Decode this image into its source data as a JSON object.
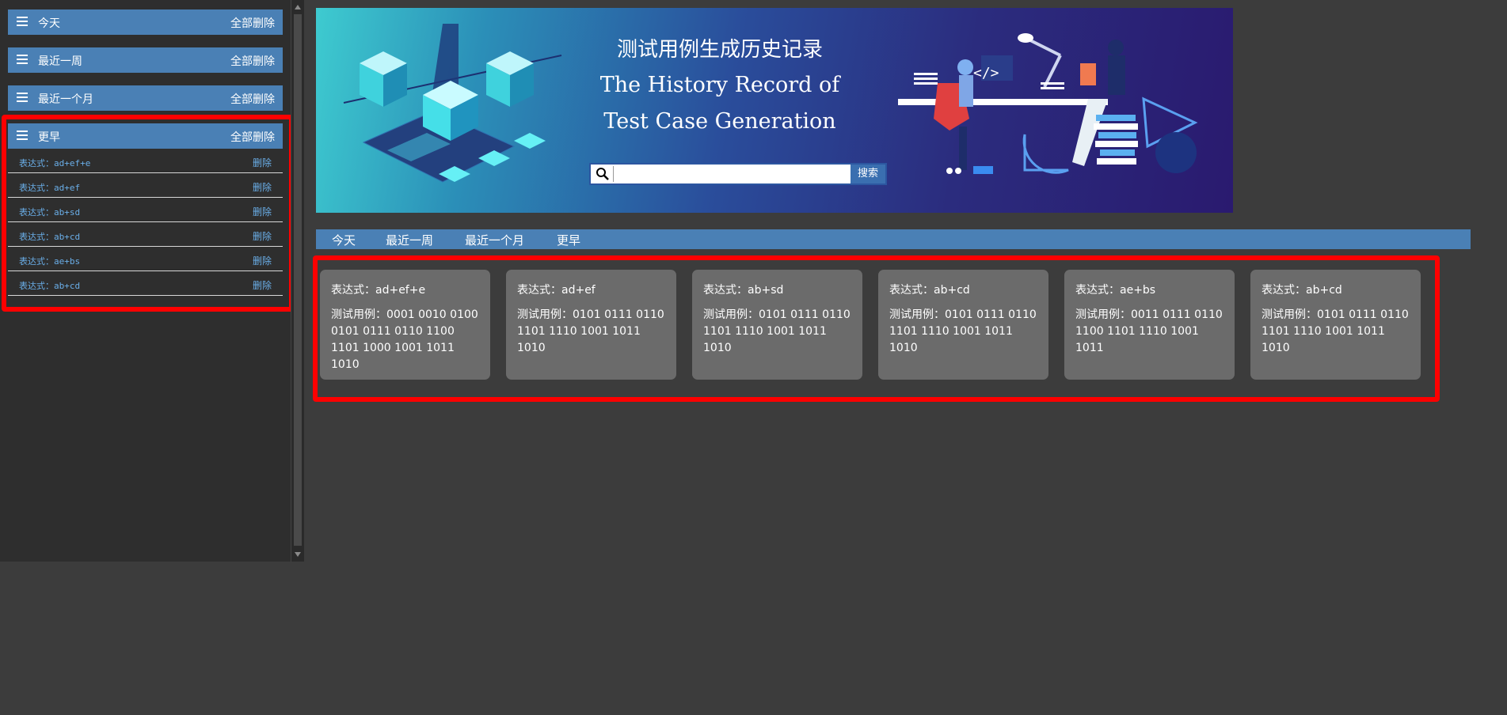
{
  "sidebar": {
    "groups": [
      {
        "title": "今天",
        "delete_all": "全部删除"
      },
      {
        "title": "最近一周",
        "delete_all": "全部删除"
      },
      {
        "title": "最近一个月",
        "delete_all": "全部删除"
      },
      {
        "title": "更早",
        "delete_all": "全部删除"
      }
    ],
    "earlier_items": [
      {
        "label": "表达式：ad+ef+e",
        "delete": "删除"
      },
      {
        "label": "表达式：ad+ef",
        "delete": "删除"
      },
      {
        "label": "表达式：ab+sd",
        "delete": "删除"
      },
      {
        "label": "表达式：ab+cd",
        "delete": "删除"
      },
      {
        "label": "表达式：ae+bs",
        "delete": "删除"
      },
      {
        "label": "表达式：ab+cd",
        "delete": "删除"
      }
    ]
  },
  "banner": {
    "title_cn": "测试用例生成历史记录",
    "title_en_line1": "The History Record of",
    "title_en_line2": "Test Case Generation",
    "search_placeholder": "",
    "search_button": "搜索",
    "code_glyph": "</>"
  },
  "tabs": [
    "今天",
    "最近一周",
    "最近一个月",
    "更早"
  ],
  "cards": [
    {
      "expression": "表达式：ad+ef+e",
      "testcase": "测试用例：0001 0010 0100 0101 0111 0110 1100 1101 1000 1001 1011 1010"
    },
    {
      "expression": "表达式：ad+ef",
      "testcase": "测试用例：0101 0111 0110 1101 1110 1001 1011 1010"
    },
    {
      "expression": "表达式：ab+sd",
      "testcase": "测试用例：0101 0111 0110 1101 1110 1001 1011 1010"
    },
    {
      "expression": "表达式：ab+cd",
      "testcase": "测试用例：0101 0111 0110 1101 1110 1001 1011 1010"
    },
    {
      "expression": "表达式：ae+bs",
      "testcase": "测试用例：0011 0111 0110 1100 1101 1110 1001 1011"
    },
    {
      "expression": "表达式：ab+cd",
      "testcase": "测试用例：0101 0111 0110 1101 1110 1001 1011 1010"
    }
  ],
  "colors": {
    "background": "#3c3c3c",
    "sidebar_bg": "#2e2e2e",
    "header_blue": "#4a80b5",
    "link_blue": "#6aaee8",
    "card_bg": "#6b6b6b",
    "highlight_red": "#ff0000"
  }
}
